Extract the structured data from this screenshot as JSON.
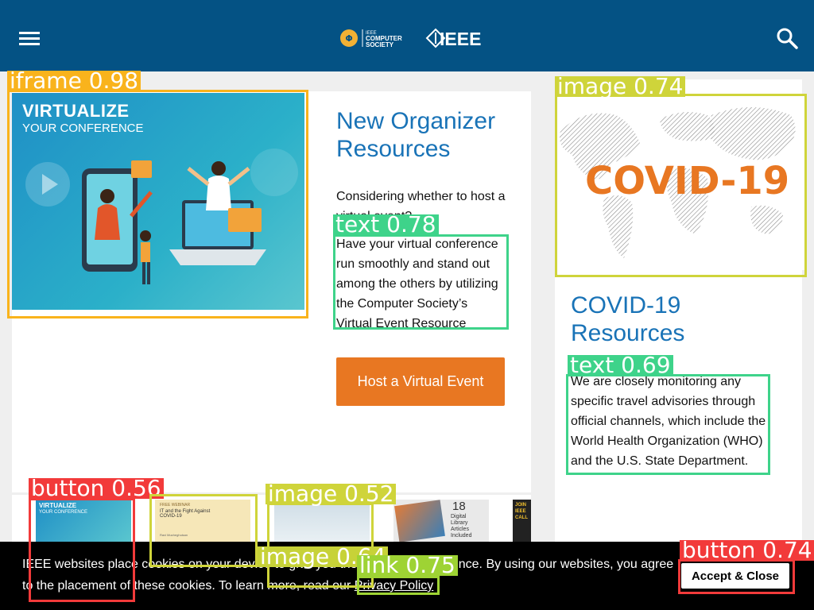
{
  "header": {
    "cs_logo_line1": "IEEE",
    "cs_logo_line2": "COMPUTER",
    "cs_logo_line3": "SOCIETY",
    "ieee_logo_text": "IEEE",
    "menu_icon": "hamburger-icon",
    "search_icon": "search-icon"
  },
  "hero": {
    "image_title_1": "VIRTUALIZE",
    "image_title_2": "YOUR CONFERENCE",
    "heading": "New Organizer Resources",
    "intro": "Considering whether to host a virtual event?",
    "body": "Have your virtual conference run smoothly and stand out among the others by utilizing the Computer Society’s Virtual Event Resource Guide!",
    "cta_label": "Host a Virtual Event"
  },
  "covid": {
    "image_text": "COVID-19",
    "heading": "COVID-19 Resources",
    "body": "We are closely monitoring any specific travel advisories through official channels, which include the World Health Organization (WHO) and the U.S. State Department."
  },
  "carousel": {
    "thumb1_line1": "VIRTUALIZE",
    "thumb1_line2": "YOUR CONFERENCE",
    "thumb2_line1": "FREE WEBINAR",
    "thumb2_line2": "IT and the Fight Against COVID-19",
    "thumb2_line3": "Ravi Mucheghuisan",
    "thumb4_num": "18",
    "thumb4_line1": "Digital",
    "thumb4_line2": "Library",
    "thumb4_line3": "Articles",
    "thumb4_line4": "Included",
    "thumb5_text": "JOIN IEEE CALL"
  },
  "cookie": {
    "text_before": "IEEE websites place cookies on your device to give you the best user experience. By using our websites, you agree to the placement of these cookies. To learn more, read our ",
    "link": "Privacy Policy",
    "accept": "Accept & Close"
  },
  "detections": [
    {
      "label": "iframe 0.98",
      "color": "#f9b31c"
    },
    {
      "label": "text 0.78",
      "color": "#3ed38a"
    },
    {
      "label": "image 0.74",
      "color": "#cfd43a"
    },
    {
      "label": "text 0.69",
      "color": "#3ed38a"
    },
    {
      "label": "button 0.56",
      "color": "#f23a3a"
    },
    {
      "label": "image 0.52",
      "color": "#cfd43a"
    },
    {
      "label": "image 0.64",
      "color": "#c7d238"
    },
    {
      "label": "link 0.75",
      "color": "#9ed334"
    },
    {
      "label": "button 0.74",
      "color": "#f23a3a"
    }
  ]
}
